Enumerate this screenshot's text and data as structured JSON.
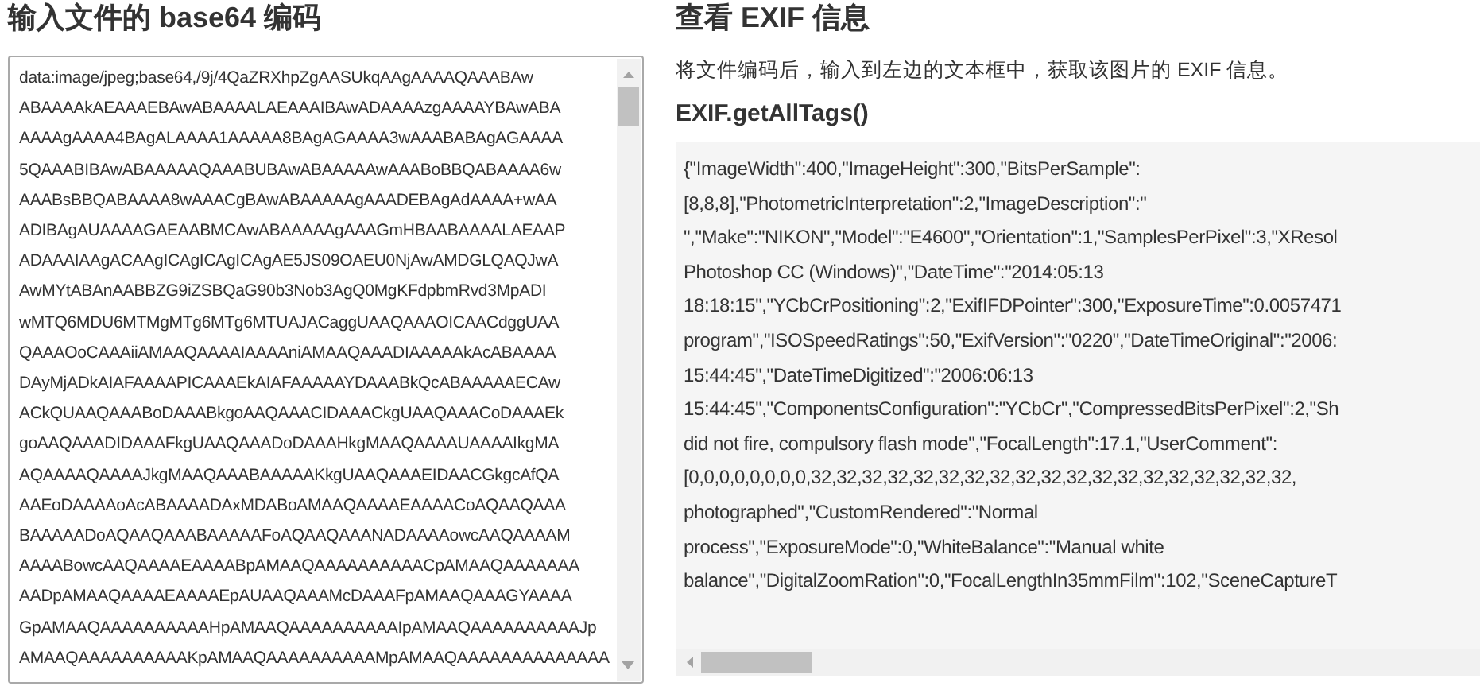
{
  "left": {
    "heading": "输入文件的 base64 编码",
    "textarea": {
      "lines": [
        "data:image/jpeg;base64,/9j/4QaZRXhpZgAASUkqAAgAAAAQAAABAw",
        "ABAAAAkAEAAAEBAwABAAAALAEAAAIBAwADAAAAzgAAAAYBAwABA",
        "AAAAgAAAA4BAgALAAAA1AAAAA8BAgAGAAAA3wAAABABAgAGAAAA",
        "5QAAABIBAwABAAAAAQAAABUBAwABAAAAAwAAABoBBQABAAAA6w",
        "AAABsBBQABAAAA8wAAACgBAwABAAAAAgAAADEBAgAdAAAA+wAA",
        "ADIBAgAUAAAAGAEAABMCAwABAAAAAgAAAGmHBAABAAAALAEAAP",
        "ADAAAIAAgACAAgICAgICAgICAgAE5JS09OAEU0NjAwAMDGLQAQJwA",
        "AwMYtABAnAABBZG9iZSBQaG90b3Nob3AgQ0MgKFdpbmRvd3MpADI",
        "wMTQ6MDU6MTMgMTg6MTg6MTUAJACaggUAAQAAAOICAACdggUAA",
        "QAAAOoCAAAiiAMAAQAAAAIAAAAniAMAAQAAADIAAAAAkAcABAAAA",
        "DAyMjADkAIAFAAAAPICAAAEkAIAFAAAAAYDAAABkQcABAAAAAECAw",
        "ACkQUAAQAAABoDAAABkgoAAQAAACIDAAACkgUAAQAAACoDAAAEk",
        "goAAQAAADIDAAAFkgUAAQAAADoDAAAHkgMAAQAAAAUAAAAIkgMA",
        "AQAAAAQAAAAJkgMAAQAAABAAAAAKkgUAAQAAAEIDAACGkgcAfQA",
        "AAEoDAAAAoAcABAAAADAxMDABoAMAAQAAAAEAAAACoAQAAQAAA",
        "BAAAAADoAQAAQAAABAAAAAFoAQAAQAAANADAAAAowcAAQAAAAM",
        "AAAABowcAAQAAAAEAAAABpAMAAQAAAAAAAAAACpAMAAQAAAAAAA",
        "AADpAMAAQAAAAEAAAAEpAUAAQAAAMcDAAAFpAMAAQAAAGYAAAA",
        "GpAMAAQAAAAAAAAAAHpAMAAQAAAAAAAAAAIpAMAAQAAAAAAAAAAJp",
        "AMAAQAAAAAAAAAAKpAMAAQAAAAAAAAAAMpAMAAQAAAAAAAAAAAAAA"
      ]
    }
  },
  "right": {
    "heading": "查看 EXIF 信息",
    "description": "将文件编码后，输入到左边的文本框中，获取该图片的 EXIF 信息。",
    "subheading": "EXIF.getAllTags()",
    "output": {
      "lines": [
        "{\"ImageWidth\":400,\"ImageHeight\":300,\"BitsPerSample\":",
        "[8,8,8],\"PhotometricInterpretation\":2,\"ImageDescription\":\"",
        "\",\"Make\":\"NIKON\",\"Model\":\"E4600\",\"Orientation\":1,\"SamplesPerPixel\":3,\"XResol",
        "Photoshop CC (Windows)\",\"DateTime\":\"2014:05:13",
        "18:18:15\",\"YCbCrPositioning\":2,\"ExifIFDPointer\":300,\"ExposureTime\":0.0057471",
        "program\",\"ISOSpeedRatings\":50,\"ExifVersion\":\"0220\",\"DateTimeOriginal\":\"2006:",
        "15:44:45\",\"DateTimeDigitized\":\"2006:06:13",
        "15:44:45\",\"ComponentsConfiguration\":\"YCbCr\",\"CompressedBitsPerPixel\":2,\"Sh",
        "did not fire, compulsory flash mode\",\"FocalLength\":17.1,\"UserComment\":",
        "[0,0,0,0,0,0,0,0,32,32,32,32,32,32,32,32,32,32,32,32,32,32,32,32,32,32,32,",
        "photographed\",\"CustomRendered\":\"Normal",
        "process\",\"ExposureMode\":0,\"WhiteBalance\":\"Manual white",
        "balance\",\"DigitalZoomRation\":0,\"FocalLengthIn35mmFilm\":102,\"SceneCaptureT"
      ]
    }
  }
}
